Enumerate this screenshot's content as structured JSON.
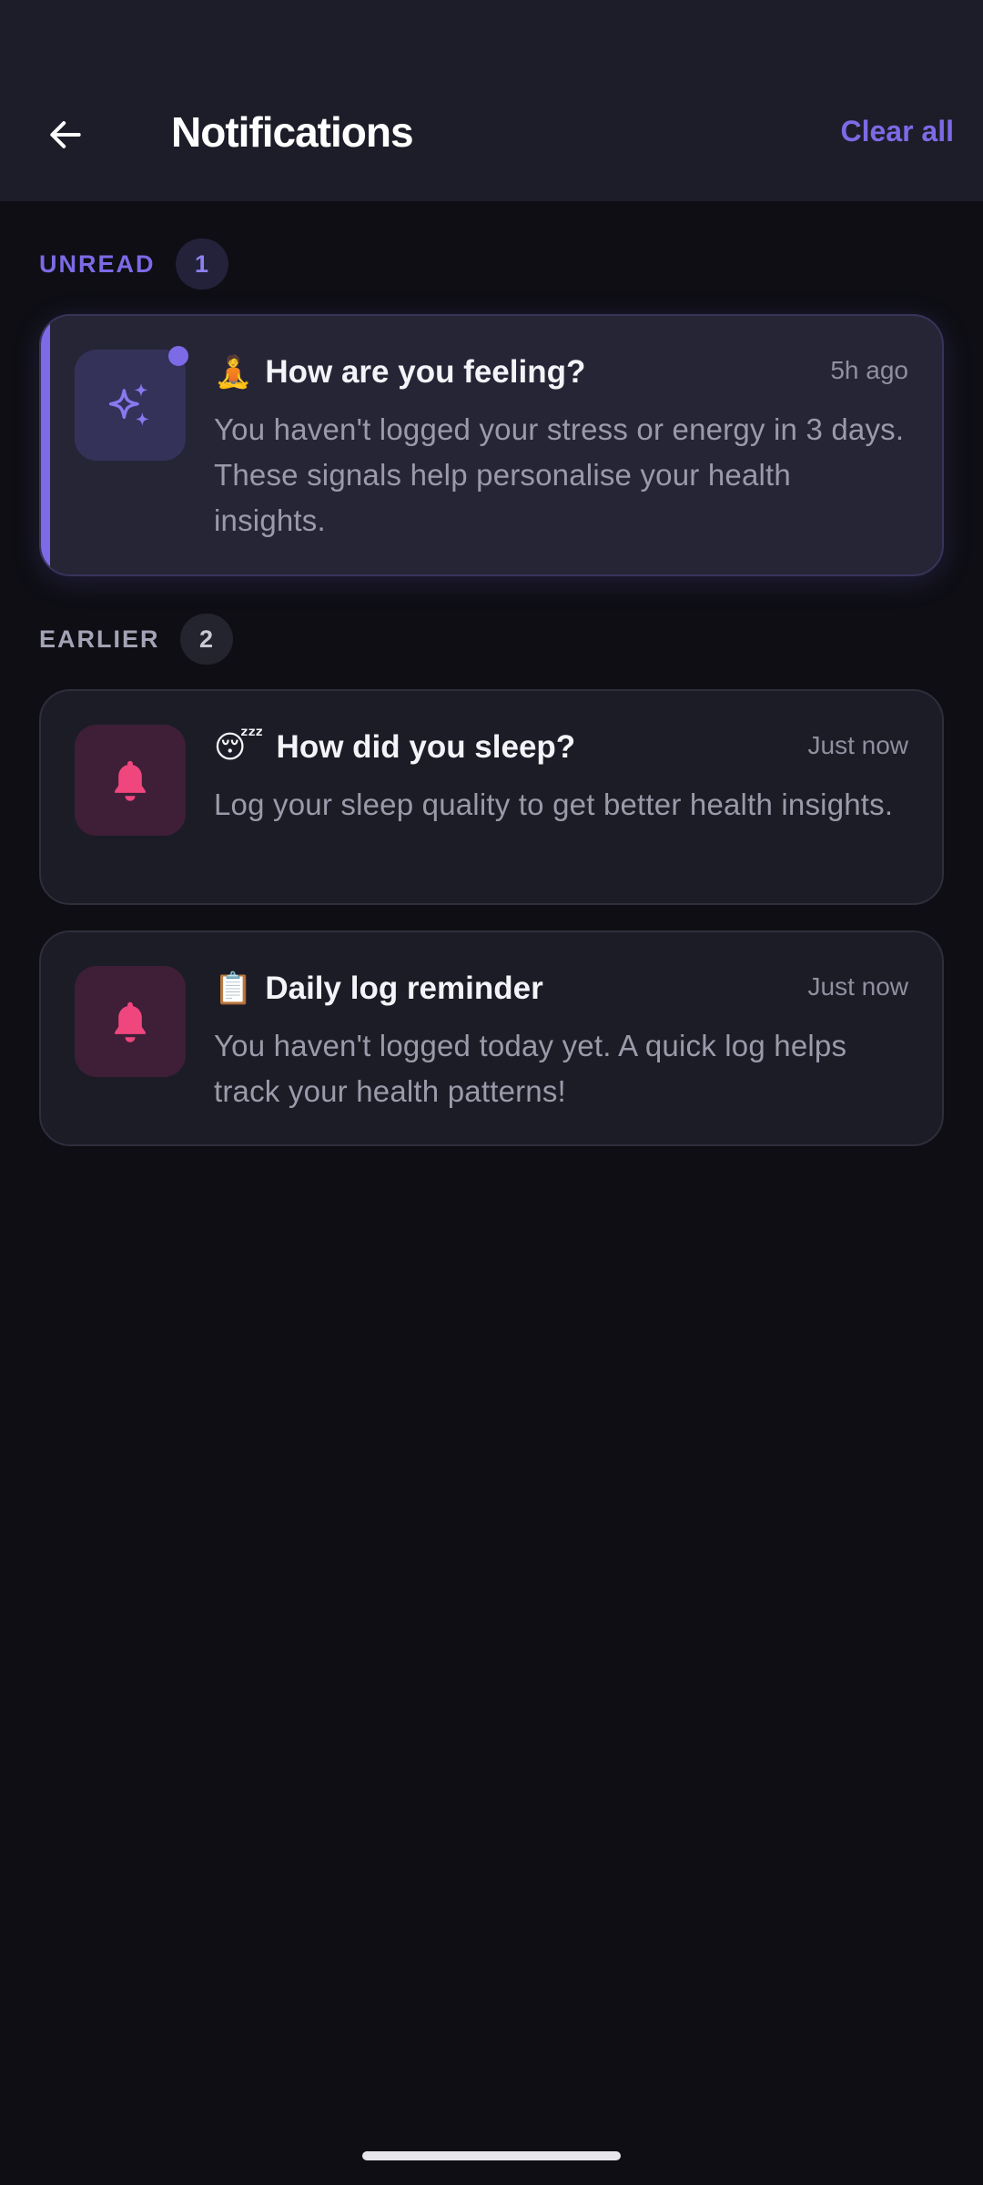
{
  "header": {
    "title": "Notifications",
    "clear_all_label": "Clear all",
    "back_icon": "arrow-left-icon"
  },
  "sections": {
    "unread": {
      "label": "UNREAD",
      "count": "1"
    },
    "earlier": {
      "label": "EARLIER",
      "count": "2"
    }
  },
  "notifications": [
    {
      "emoji": "🧘",
      "title": "How are you feeling?",
      "time": "5h ago",
      "body": "You haven't logged your stress or energy in 3 days. These signals help personalise your health insights.",
      "icon": "sparkle-icon",
      "unread": true
    },
    {
      "emoji": "😴",
      "title": "How did you sleep?",
      "time": "Just now",
      "body": "Log your sleep quality to get better health insights.",
      "icon": "bell-icon",
      "unread": false
    },
    {
      "emoji": "📋",
      "title": "Daily log reminder",
      "time": "Just now",
      "body": "You haven't logged today yet. A quick log helps track your health patterns!",
      "icon": "bell-icon",
      "unread": false
    }
  ],
  "colors": {
    "accent": "#7c6ae6",
    "bell": "#f0467e",
    "background": "#0e0e14"
  }
}
